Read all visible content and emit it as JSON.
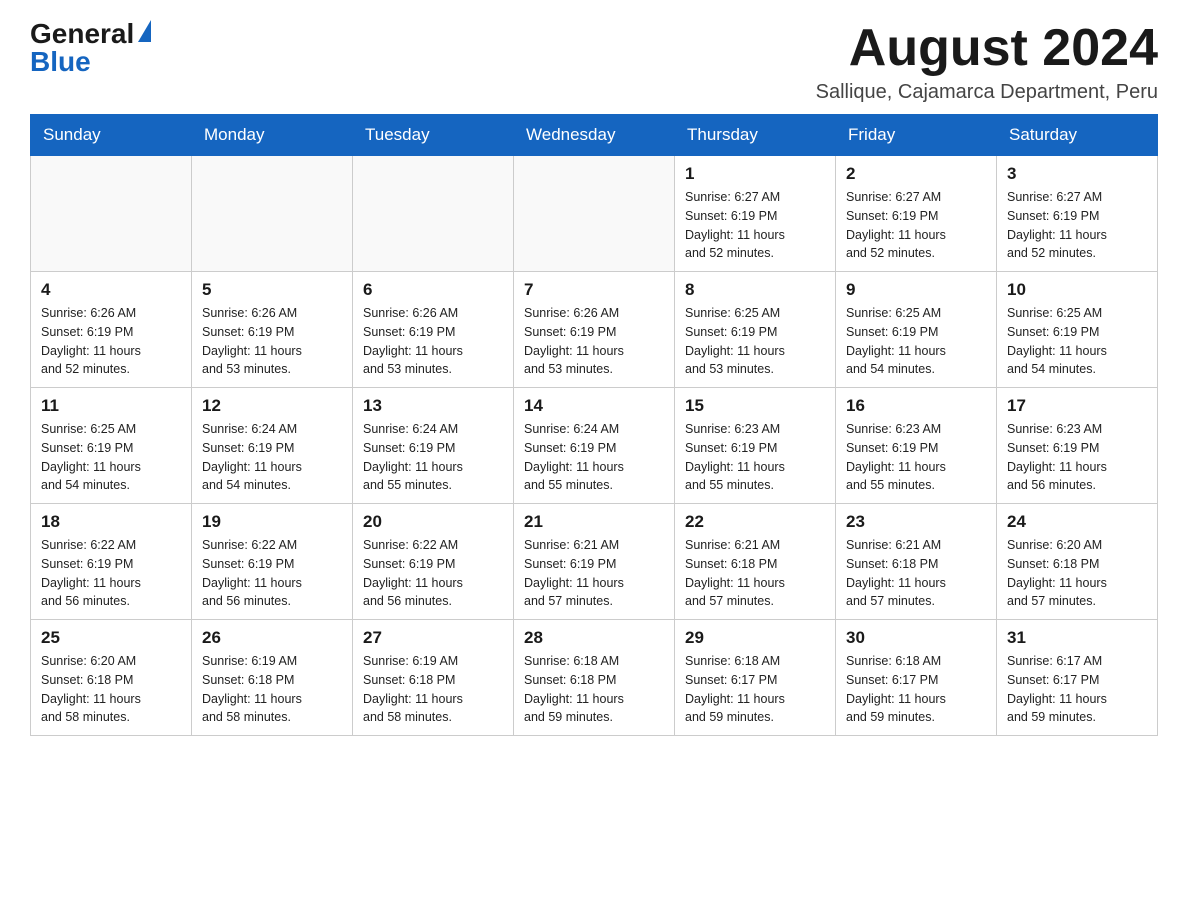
{
  "logo": {
    "general": "General",
    "blue": "Blue"
  },
  "title": {
    "month_year": "August 2024",
    "location": "Sallique, Cajamarca Department, Peru"
  },
  "headers": [
    "Sunday",
    "Monday",
    "Tuesday",
    "Wednesday",
    "Thursday",
    "Friday",
    "Saturday"
  ],
  "weeks": [
    [
      {
        "day": "",
        "info": ""
      },
      {
        "day": "",
        "info": ""
      },
      {
        "day": "",
        "info": ""
      },
      {
        "day": "",
        "info": ""
      },
      {
        "day": "1",
        "info": "Sunrise: 6:27 AM\nSunset: 6:19 PM\nDaylight: 11 hours\nand 52 minutes."
      },
      {
        "day": "2",
        "info": "Sunrise: 6:27 AM\nSunset: 6:19 PM\nDaylight: 11 hours\nand 52 minutes."
      },
      {
        "day": "3",
        "info": "Sunrise: 6:27 AM\nSunset: 6:19 PM\nDaylight: 11 hours\nand 52 minutes."
      }
    ],
    [
      {
        "day": "4",
        "info": "Sunrise: 6:26 AM\nSunset: 6:19 PM\nDaylight: 11 hours\nand 52 minutes."
      },
      {
        "day": "5",
        "info": "Sunrise: 6:26 AM\nSunset: 6:19 PM\nDaylight: 11 hours\nand 53 minutes."
      },
      {
        "day": "6",
        "info": "Sunrise: 6:26 AM\nSunset: 6:19 PM\nDaylight: 11 hours\nand 53 minutes."
      },
      {
        "day": "7",
        "info": "Sunrise: 6:26 AM\nSunset: 6:19 PM\nDaylight: 11 hours\nand 53 minutes."
      },
      {
        "day": "8",
        "info": "Sunrise: 6:25 AM\nSunset: 6:19 PM\nDaylight: 11 hours\nand 53 minutes."
      },
      {
        "day": "9",
        "info": "Sunrise: 6:25 AM\nSunset: 6:19 PM\nDaylight: 11 hours\nand 54 minutes."
      },
      {
        "day": "10",
        "info": "Sunrise: 6:25 AM\nSunset: 6:19 PM\nDaylight: 11 hours\nand 54 minutes."
      }
    ],
    [
      {
        "day": "11",
        "info": "Sunrise: 6:25 AM\nSunset: 6:19 PM\nDaylight: 11 hours\nand 54 minutes."
      },
      {
        "day": "12",
        "info": "Sunrise: 6:24 AM\nSunset: 6:19 PM\nDaylight: 11 hours\nand 54 minutes."
      },
      {
        "day": "13",
        "info": "Sunrise: 6:24 AM\nSunset: 6:19 PM\nDaylight: 11 hours\nand 55 minutes."
      },
      {
        "day": "14",
        "info": "Sunrise: 6:24 AM\nSunset: 6:19 PM\nDaylight: 11 hours\nand 55 minutes."
      },
      {
        "day": "15",
        "info": "Sunrise: 6:23 AM\nSunset: 6:19 PM\nDaylight: 11 hours\nand 55 minutes."
      },
      {
        "day": "16",
        "info": "Sunrise: 6:23 AM\nSunset: 6:19 PM\nDaylight: 11 hours\nand 55 minutes."
      },
      {
        "day": "17",
        "info": "Sunrise: 6:23 AM\nSunset: 6:19 PM\nDaylight: 11 hours\nand 56 minutes."
      }
    ],
    [
      {
        "day": "18",
        "info": "Sunrise: 6:22 AM\nSunset: 6:19 PM\nDaylight: 11 hours\nand 56 minutes."
      },
      {
        "day": "19",
        "info": "Sunrise: 6:22 AM\nSunset: 6:19 PM\nDaylight: 11 hours\nand 56 minutes."
      },
      {
        "day": "20",
        "info": "Sunrise: 6:22 AM\nSunset: 6:19 PM\nDaylight: 11 hours\nand 56 minutes."
      },
      {
        "day": "21",
        "info": "Sunrise: 6:21 AM\nSunset: 6:19 PM\nDaylight: 11 hours\nand 57 minutes."
      },
      {
        "day": "22",
        "info": "Sunrise: 6:21 AM\nSunset: 6:18 PM\nDaylight: 11 hours\nand 57 minutes."
      },
      {
        "day": "23",
        "info": "Sunrise: 6:21 AM\nSunset: 6:18 PM\nDaylight: 11 hours\nand 57 minutes."
      },
      {
        "day": "24",
        "info": "Sunrise: 6:20 AM\nSunset: 6:18 PM\nDaylight: 11 hours\nand 57 minutes."
      }
    ],
    [
      {
        "day": "25",
        "info": "Sunrise: 6:20 AM\nSunset: 6:18 PM\nDaylight: 11 hours\nand 58 minutes."
      },
      {
        "day": "26",
        "info": "Sunrise: 6:19 AM\nSunset: 6:18 PM\nDaylight: 11 hours\nand 58 minutes."
      },
      {
        "day": "27",
        "info": "Sunrise: 6:19 AM\nSunset: 6:18 PM\nDaylight: 11 hours\nand 58 minutes."
      },
      {
        "day": "28",
        "info": "Sunrise: 6:18 AM\nSunset: 6:18 PM\nDaylight: 11 hours\nand 59 minutes."
      },
      {
        "day": "29",
        "info": "Sunrise: 6:18 AM\nSunset: 6:17 PM\nDaylight: 11 hours\nand 59 minutes."
      },
      {
        "day": "30",
        "info": "Sunrise: 6:18 AM\nSunset: 6:17 PM\nDaylight: 11 hours\nand 59 minutes."
      },
      {
        "day": "31",
        "info": "Sunrise: 6:17 AM\nSunset: 6:17 PM\nDaylight: 11 hours\nand 59 minutes."
      }
    ]
  ]
}
